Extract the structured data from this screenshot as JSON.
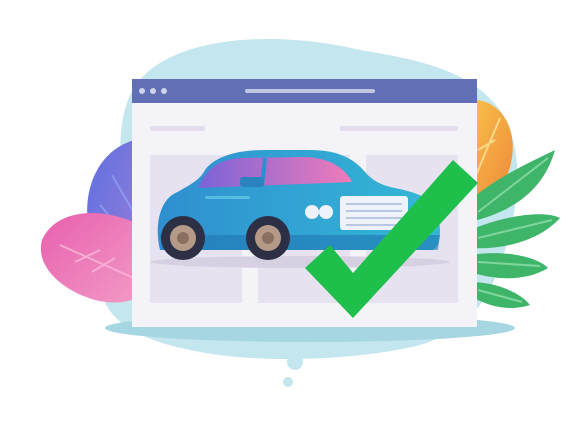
{
  "illustration": {
    "subject": "car-on-browser-window-with-checkmark",
    "icons": [
      "browser-window-icon",
      "car-icon",
      "check-mark-icon",
      "leaf-icon"
    ]
  },
  "colors": {
    "blob": "#c4e6ee",
    "browser_bar": "#6170b4",
    "browser_body": "#f4f3f8",
    "panel": "#e7e2ef",
    "car_body": "#2e9bd0",
    "car_window": "#ec6fb8",
    "check": "#1fbf4b",
    "leaf_green": "#3fb56a",
    "leaf_pink": "#e96fb3",
    "leaf_purple": "#6f73d6",
    "leaf_orange": "#f5b640"
  }
}
